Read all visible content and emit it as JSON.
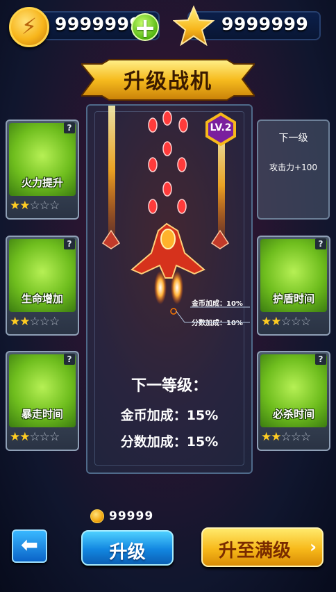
{
  "resources": {
    "gold": "9999999",
    "stars": "9999999",
    "coin_icon": "lightning-coin",
    "star_icon": "gold-star",
    "add_icon": "plus"
  },
  "title": "升级战机",
  "level_badge": "LV.2",
  "left_cards": [
    {
      "label": "火力提升",
      "help": "?",
      "stars_filled": 2,
      "stars_total": 5
    },
    {
      "label": "生命增加",
      "help": "?",
      "stars_filled": 2,
      "stars_total": 5
    },
    {
      "label": "暴走时间",
      "help": "?",
      "stars_filled": 2,
      "stars_total": 5
    }
  ],
  "right_info": {
    "title": "下一级",
    "value": "攻击力+100"
  },
  "right_cards": [
    {
      "label": "护盾时间",
      "help": "?",
      "stars_filled": 2,
      "stars_total": 5
    },
    {
      "label": "必杀时间",
      "help": "?",
      "stars_filled": 2,
      "stars_total": 5
    }
  ],
  "current_bonus": {
    "gold": "金币加成：10%",
    "score": "分数加成：10%"
  },
  "next_level": {
    "heading": "下一等级：",
    "gold": "金币加成：15%",
    "score": "分数加成：15%"
  },
  "cost": "99999",
  "buttons": {
    "back_icon": "back-arrow",
    "upgrade": "升级",
    "max_upgrade": "升至满级",
    "max_chevron": "›"
  },
  "colors": {
    "accent_gold": "#f7b91a",
    "accent_blue": "#1286e0",
    "card_green": "#6fbe1e"
  }
}
